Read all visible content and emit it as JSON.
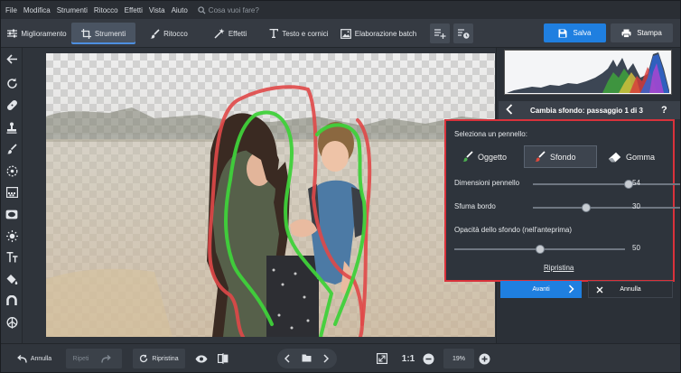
{
  "menu": [
    "File",
    "Modifica",
    "Strumenti",
    "Ritocco",
    "Effetti",
    "Vista",
    "Aiuto"
  ],
  "search_placeholder": "Cosa vuoi fare?",
  "tabs": [
    {
      "label": "Miglioramento",
      "icon": "sliders-icon",
      "active": false
    },
    {
      "label": "Strumenti",
      "icon": "crop-icon",
      "active": true
    },
    {
      "label": "Ritocco",
      "icon": "brush-icon",
      "active": false
    },
    {
      "label": "Effetti",
      "icon": "magic-wand-icon",
      "active": false
    },
    {
      "label": "Testo e cornici",
      "icon": "text-icon",
      "active": false
    },
    {
      "label": "Elaborazione batch",
      "icon": "image-stack-icon",
      "active": false
    }
  ],
  "toolbar": {
    "save": "Salva",
    "print": "Stampa"
  },
  "step": {
    "title": "Cambia sfondo: passaggio 1 di 3",
    "help": "?"
  },
  "popup": {
    "select_label": "Seleziona un pennello:",
    "brushes": [
      {
        "label": "Oggetto",
        "selected": false,
        "color": "#4caf50"
      },
      {
        "label": "Sfondo",
        "selected": true,
        "color": "#e0493b"
      },
      {
        "label": "Gomma",
        "selected": false,
        "color": "#cccccc"
      }
    ],
    "brush_size_label": "Dimensioni pennello",
    "brush_size_value": "54",
    "feather_label": "Sfuma bordo",
    "feather_value": "30",
    "opacity_label": "Opacità dello sfondo (nell'anteprima)",
    "opacity_value": "50",
    "reset_label": "Ripristina",
    "brush_size_fraction": 0.54,
    "feather_fraction": 0.3,
    "opacity_fraction": 0.5
  },
  "actions": {
    "next": "Avanti",
    "cancel": "Annulla"
  },
  "bottom": {
    "undo": "Annulla",
    "redo": "Ripeti",
    "reset": "Ripristina",
    "ratio": "1:1",
    "zoom": "19%"
  },
  "colors": {
    "accent": "#1f7fe0",
    "highlight_border": "#d9323b",
    "object_stroke": "#3fd13a",
    "background_stroke": "#e04848"
  }
}
